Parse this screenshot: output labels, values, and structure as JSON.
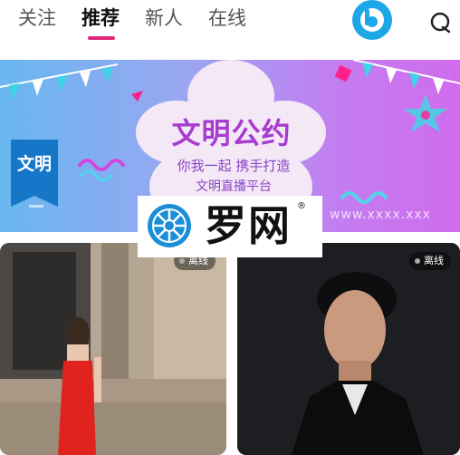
{
  "tabs": [
    {
      "label": "关注",
      "active": false
    },
    {
      "label": "推荐",
      "active": true
    },
    {
      "label": "新人",
      "active": false
    },
    {
      "label": "在线",
      "active": false
    }
  ],
  "header_icons": [
    "brand-app-icon",
    "search-icon"
  ],
  "banner": {
    "ribbon": "文明",
    "title": "文明公约",
    "line1": "你我一起 携手打造",
    "line2": "文明直播平台",
    "url": "www.xxxx.xxx"
  },
  "watermark": {
    "text": "罗网",
    "reg": "®"
  },
  "cards": [
    {
      "status": "离线"
    },
    {
      "status": "离线"
    }
  ],
  "colors": {
    "accent": "#e0287a",
    "brand": "#1ea7e6"
  }
}
